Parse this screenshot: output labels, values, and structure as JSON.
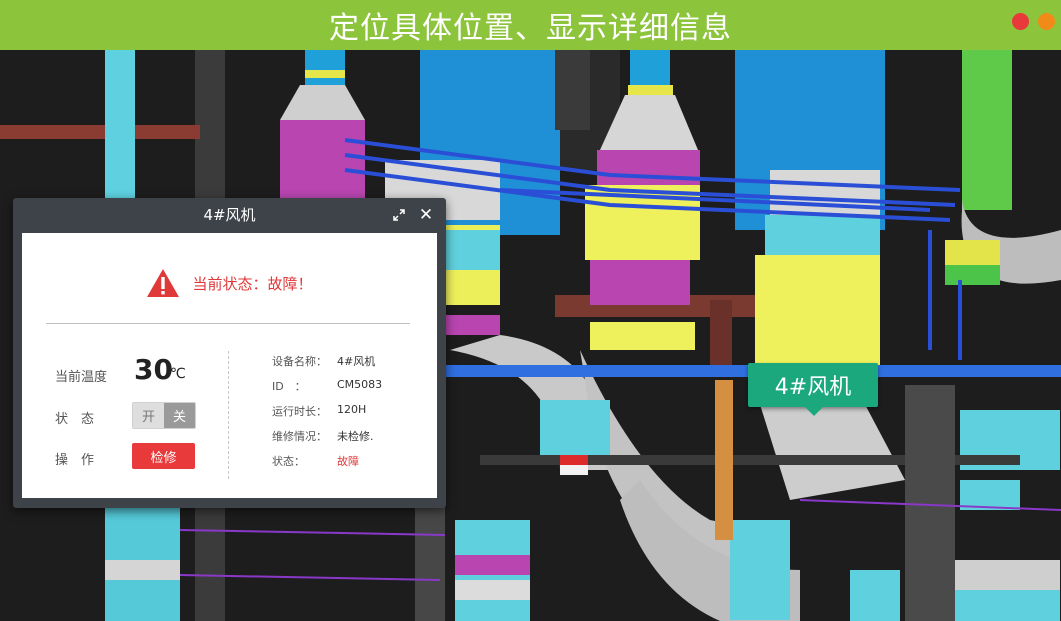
{
  "header": {
    "title": "定位具体位置、显示详细信息",
    "bg_color": "#8cc43c",
    "dot_colors": [
      "#e8393b",
      "#f28a1a"
    ]
  },
  "scene": {
    "tag_label": "4#风机"
  },
  "panel": {
    "title": "4#风机",
    "alert_text": "当前状态：故障！",
    "temperature_label": "当前温度",
    "temperature_value": "30",
    "temperature_unit": "℃",
    "status_label": "状　态",
    "toggle_on_label": "开",
    "toggle_off_label": "关",
    "operation_label": "操　作",
    "repair_button_label": "检修",
    "info": [
      {
        "key": "设备名称：",
        "value": "4#风机"
      },
      {
        "key": "ID　：",
        "value": "CM5083"
      },
      {
        "key": "运行时长：",
        "value": "120H"
      },
      {
        "key": "维修情况：",
        "value": "未检修."
      },
      {
        "key": "状态：",
        "value": "故障"
      }
    ],
    "alert_color": "#e0393a"
  }
}
